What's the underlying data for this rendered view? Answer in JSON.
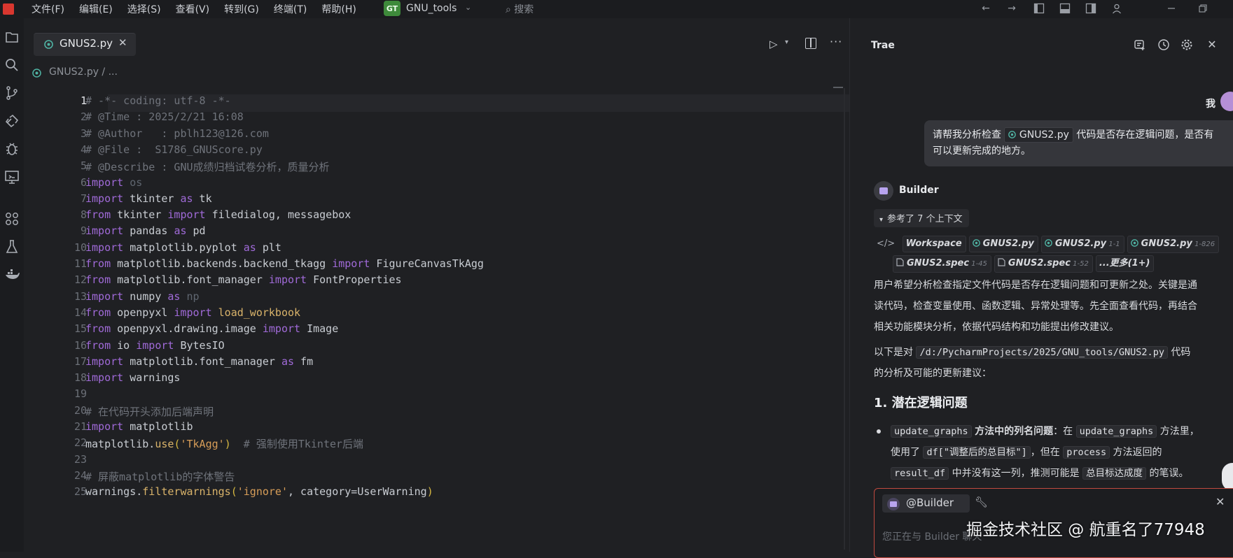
{
  "titlebar": {
    "menu": [
      "文件(F)",
      "编辑(E)",
      "选择(S)",
      "查看(V)",
      "转到(G)",
      "终端(T)",
      "帮助(H)"
    ],
    "project_badge": "GT",
    "project_name": "GNU_tools",
    "search_placeholder": "搜索"
  },
  "editor": {
    "tab_name": "GNUS2.py",
    "breadcrumb": "GNUS2.py  /  ...",
    "lines": [
      {
        "n": "1",
        "html": "<span class=\"c\"># -*- coding: utf-8 -*-</span>"
      },
      {
        "n": "2",
        "html": "<span class=\"c\"># @Time : 2025/2/21 16:08</span>"
      },
      {
        "n": "3",
        "html": "<span class=\"c\"># @Author   : pblh123@126.com</span>"
      },
      {
        "n": "4",
        "html": "<span class=\"c\"># @File :  S1786_GNUScore.py</span>"
      },
      {
        "n": "5",
        "html": "<span class=\"c\"># @Describe : GNU成绩归档试卷分析，质量分析</span>"
      },
      {
        "n": "6",
        "html": "<span class=\"k\">import</span> <span class=\"m\">os</span>"
      },
      {
        "n": "7",
        "html": "<span class=\"k\">import</span> tkinter <span class=\"k\">as</span> tk"
      },
      {
        "n": "8",
        "html": "<span class=\"k\">from</span> tkinter <span class=\"k\">import</span> filedialog, messagebox"
      },
      {
        "n": "9",
        "html": "<span class=\"k\">import</span> pandas <span class=\"k\">as</span> pd"
      },
      {
        "n": "10",
        "html": "<span class=\"k\">import</span> matplotlib.pyplot <span class=\"k\">as</span> plt"
      },
      {
        "n": "11",
        "html": "<span class=\"k\">from</span> matplotlib.backends.backend_tkagg <span class=\"k\">import</span> FigureCanvasTkAgg"
      },
      {
        "n": "12",
        "html": "<span class=\"k\">from</span> matplotlib.font_manager <span class=\"k\">import</span> FontProperties"
      },
      {
        "n": "13",
        "html": "<span class=\"k\">import</span> numpy <span class=\"k\">as</span> <span class=\"m\">np</span>"
      },
      {
        "n": "14",
        "html": "<span class=\"k\">from</span> openpyxl <span class=\"k\">import</span> <span class=\"mo\">load_workbook</span>"
      },
      {
        "n": "15",
        "html": "<span class=\"k\">from</span> openpyxl.drawing.image <span class=\"k\">import</span> Image"
      },
      {
        "n": "16",
        "html": "<span class=\"k\">from</span> io <span class=\"k\">import</span> BytesIO"
      },
      {
        "n": "17",
        "html": "<span class=\"k\">import</span> matplotlib.font_manager <span class=\"k\">as</span> fm"
      },
      {
        "n": "18",
        "html": "<span class=\"k\">import</span> warnings"
      },
      {
        "n": "19",
        "html": ""
      },
      {
        "n": "20",
        "html": "<span class=\"c\"># 在代码开头添加后端声明</span>"
      },
      {
        "n": "21",
        "html": "<span class=\"k\">import</span> matplotlib"
      },
      {
        "n": "22",
        "html": "matplotlib.<span class=\"mo\">use</span><span class=\"p\">(</span><span class=\"s\">'TkAgg'</span><span class=\"p\">)</span>  <span class=\"c\"># 强制使用Tkinter后端</span>"
      },
      {
        "n": "23",
        "html": ""
      },
      {
        "n": "24",
        "html": "<span class=\"c\"># 屏蔽matplotlib的字体警告</span>"
      },
      {
        "n": "25",
        "html": "warnings.<span class=\"mo\">filterwarnings</span><span class=\"p\">(</span><span class=\"s\">'ignore'</span>, category=UserWarning<span class=\"p\">)</span>"
      }
    ]
  },
  "panel": {
    "title": "Trae",
    "user_label": "我",
    "user_message_pre": "请帮我分析检查",
    "user_message_chip": "GNUS2.py",
    "user_message_post": "代码是否存在逻辑问题，是否有",
    "user_message_line2": "可以更新完成的地方。",
    "assistant_name": "Builder",
    "ref_toggle": "参考了 7 个上下文",
    "refs_row1": [
      {
        "name": "Workspace",
        "range": ""
      },
      {
        "name": "GNUS2.py",
        "range": ""
      },
      {
        "name": "GNUS2.py",
        "range": "1-1"
      },
      {
        "name": "GNUS2.py",
        "range": "1-826"
      }
    ],
    "refs_row2": [
      {
        "name": "GNUS2.spec",
        "range": "1-45"
      },
      {
        "name": "GNUS2.spec",
        "range": "1-52"
      },
      {
        "name": "...更多(1+)",
        "range": ""
      }
    ],
    "para1": [
      "用户希望分析检查指定文件代码是否存在逻辑问题和可更新之处。关键是通",
      "读代码，检查变量使用、函数逻辑、异常处理等。先全面查看代码，再结合",
      "相关功能模块分析，依据代码结构和功能提出修改建议。"
    ],
    "para2_pre": "以下是对",
    "para2_code": "/d:/PycharmProjects/2025/GNU_tools/GNUS2.py",
    "para2_post": "代码",
    "para2_line2": "的分析及可能的更新建议：",
    "heading": "1. 潜在逻辑问题",
    "bullet_code1": "update_graphs",
    "bullet_bold": "方法中的列名问题",
    "bullet_t1": "：在",
    "bullet_code2": "update_graphs",
    "bullet_t2": "方法里，",
    "bullet_l2_t1": "使用了",
    "bullet_l2_code1": "df[\"调整后的总目标\"]",
    "bullet_l2_t2": "，但在",
    "bullet_l2_code2": "process",
    "bullet_l2_t3": "方法返回的",
    "bullet_l3_code1": "result_df",
    "bullet_l3_t1": "中并没有这一列，推测可能是",
    "bullet_l3_code2": "总目标达成度",
    "bullet_l3_t2": "的笔误。",
    "input_mention": "@Builder",
    "input_placeholder": "您正在与 Builder 聊天"
  },
  "watermark": "掘金技术社区 @ 航重名了77948"
}
